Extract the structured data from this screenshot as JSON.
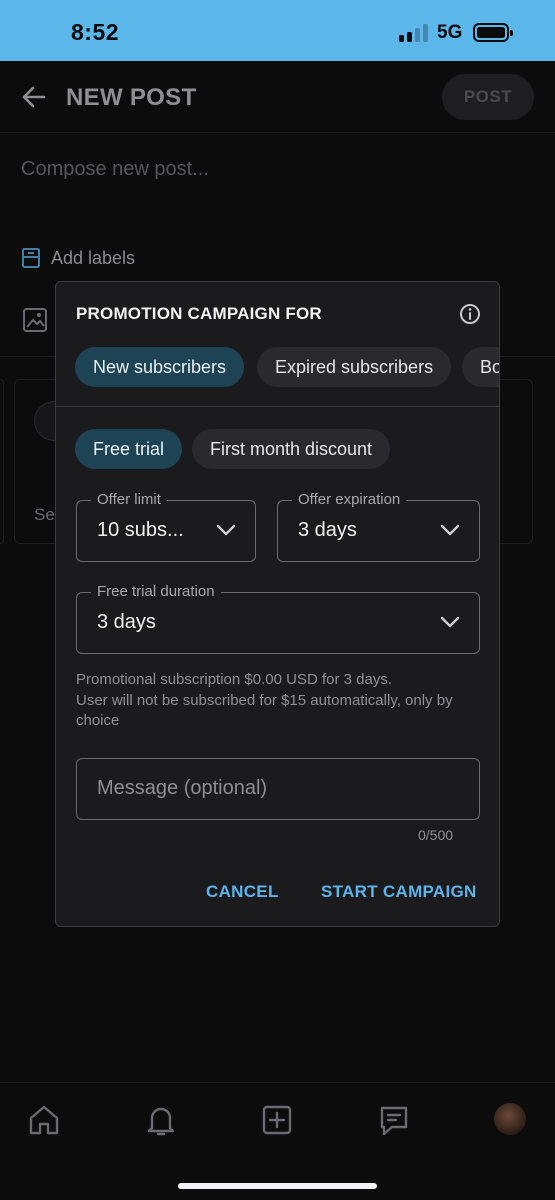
{
  "status_bar": {
    "time": "8:52",
    "network": "5G"
  },
  "header": {
    "title": "NEW POST",
    "post_label": "POST"
  },
  "composer": {
    "placeholder": "Compose new post...",
    "add_labels": "Add labels"
  },
  "background": {
    "card_text": "Se"
  },
  "modal": {
    "title": "PROMOTION CAMPAIGN FOR",
    "audience_chips": [
      {
        "label": "New subscribers",
        "selected": true
      },
      {
        "label": "Expired subscribers",
        "selected": false
      },
      {
        "label": "Bo",
        "selected": false
      }
    ],
    "offer_chips": [
      {
        "label": "Free trial",
        "selected": true
      },
      {
        "label": "First month discount",
        "selected": false
      }
    ],
    "offer_limit": {
      "label": "Offer limit",
      "value": "10 subs..."
    },
    "offer_expiration": {
      "label": "Offer expiration",
      "value": "3 days"
    },
    "trial_duration": {
      "label": "Free trial duration",
      "value": "3 days"
    },
    "helper_line1": "Promotional subscription $0.00 USD for 3 days.",
    "helper_line2": "User will not be subscribed for $15 automatically, only by choice",
    "message": {
      "placeholder": "Message (optional)",
      "counter": "0/500"
    },
    "cancel_label": "CANCEL",
    "start_label": "START CAMPAIGN"
  },
  "colors": {
    "status_bar": "#5bb6ea",
    "accent": "#5db3ea",
    "chip_active": "#1d4354",
    "modal_bg": "#1b1b1e"
  },
  "icons": [
    "back-arrow-icon",
    "label-icon",
    "image-icon",
    "info-icon",
    "chevron-down-icon",
    "home-icon",
    "bell-icon",
    "add-icon",
    "message-icon"
  ]
}
